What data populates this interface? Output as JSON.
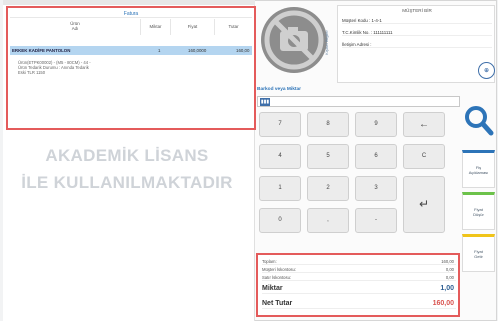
{
  "invoice": {
    "header": "Fatura",
    "col_name_1": "Ürün",
    "col_name_2": "Adı",
    "col_qty": "Miktar",
    "col_price": "Fiyat",
    "col_total": "Tutar",
    "selected_row": {
      "name": "ERKEK KADİFE PANTOLON",
      "qty": "1",
      "price": "160,0000",
      "total": "160,00"
    },
    "details_line1": "Ürün(ETPK00002) - (M5 - 80CM) - 44 -",
    "details_line2": "Ürün Tedarik Durumu : Anında Tedarik",
    "details_line3": "Eski TLR 1150"
  },
  "watermark": {
    "line1": "AKADEMİK LİSANS",
    "line2": "İLE KULLANILMAKTADIR"
  },
  "customer": {
    "title": "MÜŞTERİ BİR",
    "code": "Müşteri Kodu :  1-4-1",
    "tax_no": "T.C.Kimlik No. :  111111111",
    "address": "İletişim Adresi :",
    "side_label": "Kişisel Bilgiler",
    "add_label": "⊕"
  },
  "barcode": {
    "label": "Barkod veya Miktar",
    "icon": "barcode-icon",
    "btn": "▮▮▮"
  },
  "keypad": {
    "k7": "7",
    "k8": "8",
    "k9": "9",
    "back": "←",
    "k4": "4",
    "k5": "5",
    "k6": "6",
    "clear": "C",
    "k1": "1",
    "k2": "2",
    "k3": "3",
    "enter": "↵",
    "k0": "0",
    "comma": ",",
    "minus": "-"
  },
  "side_buttons": {
    "b1_line1": "Fiş",
    "b1_line2": "Açıklaması",
    "b2_line1": "Fiyat",
    "b2_line2": "Düşür",
    "b3_line1": "Fiyat",
    "b3_line2": "Getir"
  },
  "totals": {
    "subtotal_label": "Toplam:",
    "subtotal_value": "160,00",
    "cust_discount_label": "Müşteri İskontosu:",
    "cust_discount_value": "0,00",
    "line_discount_label": "Satır İskontosu:",
    "line_discount_value": "0,00",
    "qty_label": "Miktar",
    "qty_value": "1,00",
    "net_label": "Net Tutar",
    "net_value": "160,00"
  },
  "colors": {
    "accent": "#2d74b8",
    "highlight": "#e45b5b",
    "selected_row": "#b4d5f0"
  }
}
